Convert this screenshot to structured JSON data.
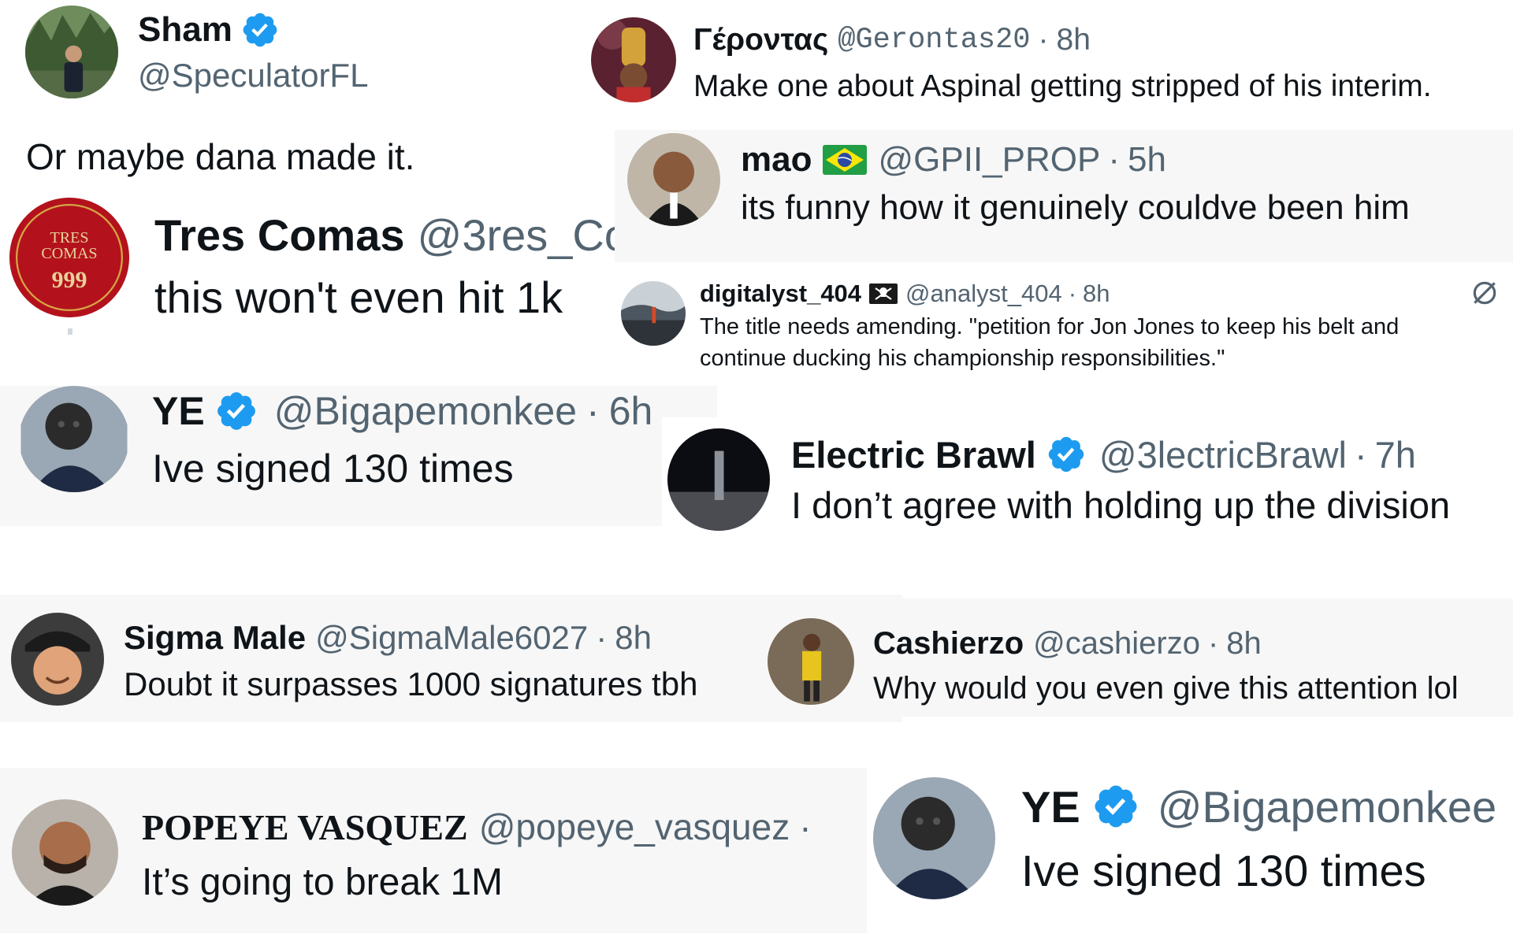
{
  "tweets": {
    "sham": {
      "name": "Sham",
      "handle": "@SpeculatorFL",
      "text": "Or maybe dana made it."
    },
    "gerontas": {
      "name": "Γέροντας",
      "handle": "@Gerontas20",
      "sep": "·",
      "time": "8h",
      "text": "Make one about Aspinal getting stripped of his interim."
    },
    "mao": {
      "name": "mao",
      "handle": "@GPII_PROP",
      "sep": "·",
      "time": "5h",
      "text": "its funny how it genuinely couldve been him"
    },
    "tres": {
      "name": "Tres Comas",
      "handle": "@3res_Co",
      "text": "this won't even hit 1k",
      "avatar_text_top": "TRES",
      "avatar_text_mid": "COMAS",
      "avatar_text_num": "999"
    },
    "digitalyst": {
      "name": "digitalyst_404",
      "handle": "@analyst_404",
      "sep": "·",
      "time": "8h",
      "text_line1": "The title needs amending. \"petition for Jon Jones to keep his belt and",
      "text_line2": "continue ducking his championship responsibilities.\""
    },
    "ye1": {
      "name": "YE",
      "handle": "@Bigapemonkee",
      "sep": "·",
      "time": "6h",
      "text": "Ive signed 130 times"
    },
    "electric": {
      "name": "Electric Brawl",
      "handle": "@3lectricBrawl",
      "sep": "·",
      "time": "7h",
      "text": "I don’t agree with holding up the division"
    },
    "sigma": {
      "name": "Sigma Male",
      "handle": "@SigmaMale6027",
      "sep": "·",
      "time": "8h",
      "text": "Doubt it surpasses 1000 signatures tbh"
    },
    "cashierzo": {
      "name": "Cashierzo",
      "handle": "@cashierzo",
      "sep": "·",
      "time": "8h",
      "text": "Why would you even give this attention lol"
    },
    "popeye": {
      "name": "POPEYE VASQUEZ",
      "handle": "@popeye_vasquez",
      "sep": "·",
      "text": "It’s going to break 1M"
    },
    "ye2": {
      "name": "YE",
      "handle": "@Bigapemonkee",
      "text": "Ive signed 130 times"
    }
  },
  "icons": {
    "verified": "verified-badge-icon",
    "flag": "brazil-flag-icon",
    "pirate": "pirate-flag-icon",
    "nofollow": "slashed-circle-icon"
  },
  "colors": {
    "verified_blue": "#1d9bf0",
    "text": "#0f1419",
    "muted": "#536471",
    "tile_gray": "#f7f7f7"
  }
}
